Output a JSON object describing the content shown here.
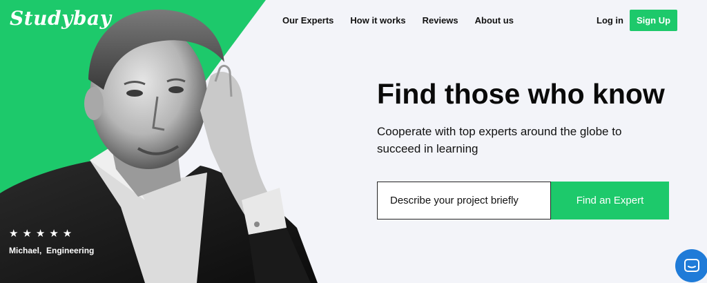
{
  "brand": {
    "logo": "Studybay",
    "accent": "#1dc96b",
    "chat_color": "#1f7bd8"
  },
  "nav": {
    "items": [
      "Our Experts",
      "How it works",
      "Reviews",
      "About us"
    ],
    "login": "Log in",
    "signup": "Sign Up"
  },
  "hero": {
    "title": "Find those who know",
    "subtitle": "Cooperate with top experts around the globe to succeed in learning",
    "search_placeholder": "Describe your project briefly",
    "cta": "Find an Expert"
  },
  "testimonial": {
    "stars": "★★★★★",
    "rating": 5,
    "name": "Michael,  Engineering"
  },
  "icons": {
    "chat": "chat-bubble-icon"
  }
}
